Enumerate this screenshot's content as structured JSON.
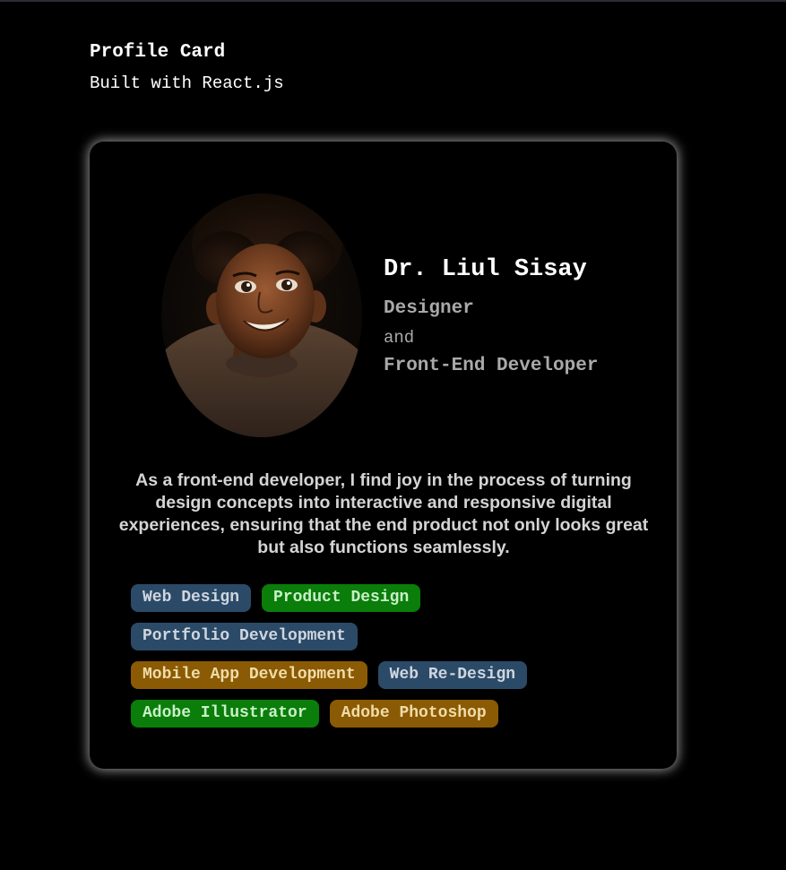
{
  "header": {
    "title": "Profile Card",
    "subtitle": "Built with React.js"
  },
  "profile": {
    "avatar_icon": "portrait-photo",
    "name": "Dr. Liul Sisay",
    "role_primary": "Designer",
    "conjunction": "and",
    "role_secondary": "Front-End Developer",
    "bio": "As a front-end developer, I find joy in the process of turning design concepts into interactive and responsive digital experiences, ensuring that the end product not only looks great but also functions seamlessly."
  },
  "skills": [
    {
      "label": "Web Design",
      "color": "#2b4a68"
    },
    {
      "label": "Product Design",
      "color": "#0a7d0a"
    },
    {
      "label": "Portfolio Development",
      "color": "#2b4a68"
    },
    {
      "label": "Mobile App Development",
      "color": "#8a5a04"
    },
    {
      "label": "Web Re-Design",
      "color": "#2b4a68"
    },
    {
      "label": "Adobe Illustrator",
      "color": "#0a7d0a"
    },
    {
      "label": "Adobe Photoshop",
      "color": "#8a5a04"
    }
  ],
  "colors": {
    "background": "#000000",
    "card_glow": "#ffffff",
    "muted_text": "#a9a9a9"
  }
}
